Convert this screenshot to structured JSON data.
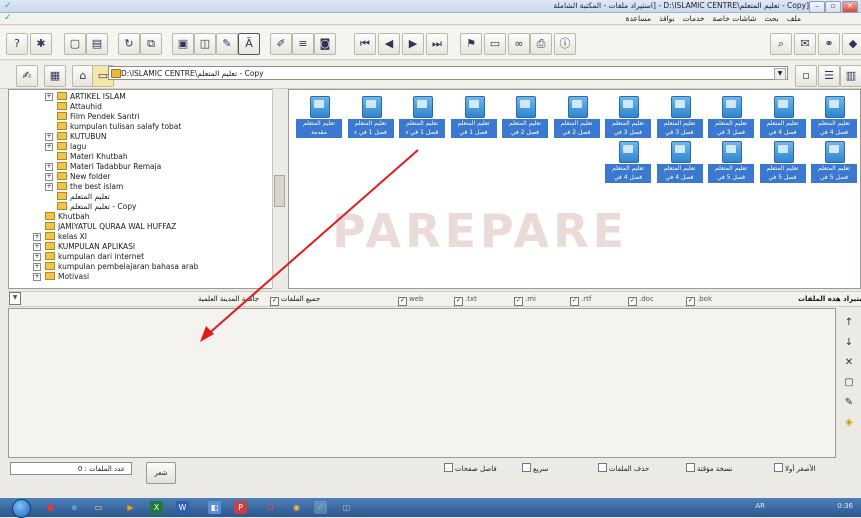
{
  "window": {
    "title": "[Copy - تعليم المتعلم\\D:\\ISLAMIC CENTRE - [استيراد ملفات - المكتبة الشاملة"
  },
  "menu": [
    "ملف",
    "بحث",
    "شاشات خاصة",
    "خدمات",
    "نوافذ",
    "مساعدة"
  ],
  "address": {
    "path": "D:\\ISLAMIC CENTRE\\تعليم المتعلم - Copy"
  },
  "tree": [
    {
      "label": "ARTIKEL ISLAM",
      "indent": 1,
      "expander": "+"
    },
    {
      "label": "Attauhid",
      "indent": 1,
      "expander": ""
    },
    {
      "label": "Film Pendek Santri",
      "indent": 1,
      "expander": ""
    },
    {
      "label": "kumpulan tulisan salafy tobat",
      "indent": 1,
      "expander": ""
    },
    {
      "label": "KUTUBUN",
      "indent": 1,
      "expander": "+"
    },
    {
      "label": "lagu",
      "indent": 1,
      "expander": "+"
    },
    {
      "label": "Materi Khutbah",
      "indent": 1,
      "expander": ""
    },
    {
      "label": "Materi Tadabbur Remaja",
      "indent": 1,
      "expander": "+"
    },
    {
      "label": "New folder",
      "indent": 1,
      "expander": "+"
    },
    {
      "label": "the best islam",
      "indent": 1,
      "expander": "+"
    },
    {
      "label": "تعليم المتعلم",
      "indent": 1,
      "expander": ""
    },
    {
      "label": "تعليم المتعلم - Copy",
      "indent": 1,
      "expander": ""
    },
    {
      "label": "Khutbah",
      "indent": 0,
      "expander": ""
    },
    {
      "label": "JAMIYATUL QURAA WAL HUFFAZ",
      "indent": 0,
      "expander": ""
    },
    {
      "label": "kelas XI",
      "indent": 0,
      "expander": "+"
    },
    {
      "label": "KUMPULAN APLIKASI",
      "indent": 0,
      "expander": "+"
    },
    {
      "label": "kumpulan dari internet",
      "indent": 0,
      "expander": "+"
    },
    {
      "label": "kumpulan pembelajaran bahasa arab",
      "indent": 0,
      "expander": "+"
    },
    {
      "label": "Motivasi",
      "indent": 0,
      "expander": "+"
    }
  ],
  "files": [
    "تعليم المتعلم فصل 4 في",
    "تعليم المتعلم فصل 4 في",
    "تعليم المتعلم فصل 3 في",
    "تعليم المتعلم فصل 3 في",
    "تعليم المتعلم فصل 3 في",
    "تعليم المتعلم فصل 2 في",
    "تعليم المتعلم فصل 2 في",
    "تعليم المتعلم فصل 1 في",
    "تعليم المتعلم فصل 1 في ء",
    "تعليم المتعلم فصل 1 في ء",
    "تعليم المتعلم مقدمة",
    "تعليم المتعلم فصل 5 في",
    "تعليم المتعلم فصل 5 في",
    "تعليم المتعلم فصل 5 في",
    "تعليم المتعلم فصل 4 في",
    "تعليم المتعلم فصل 4 في"
  ],
  "watermark": "PAREPARE",
  "filters": {
    "title": "استيراد هذه الملفات",
    "bok": ".bok",
    "doc": ".doc",
    "rtf": ".rtf",
    "mi": ".mi",
    "txt": ".txt",
    "web": "web",
    "all_files": "جميع الملفات",
    "univ": "جامعة المدينة العلمية"
  },
  "bottom": {
    "count_label": "عدد الملفات :",
    "count_value": "0",
    "poetry_button": "شعر",
    "opt_small_first": "الأصغر أولا",
    "opt_temp_copy": "نسخة مؤقتة",
    "opt_delete_files": "حذف الملفات",
    "opt_fast": "سريع",
    "opt_page_sep": "فاصل صفحات"
  },
  "taskbar": {
    "lang": "AR",
    "time": "0:36"
  }
}
